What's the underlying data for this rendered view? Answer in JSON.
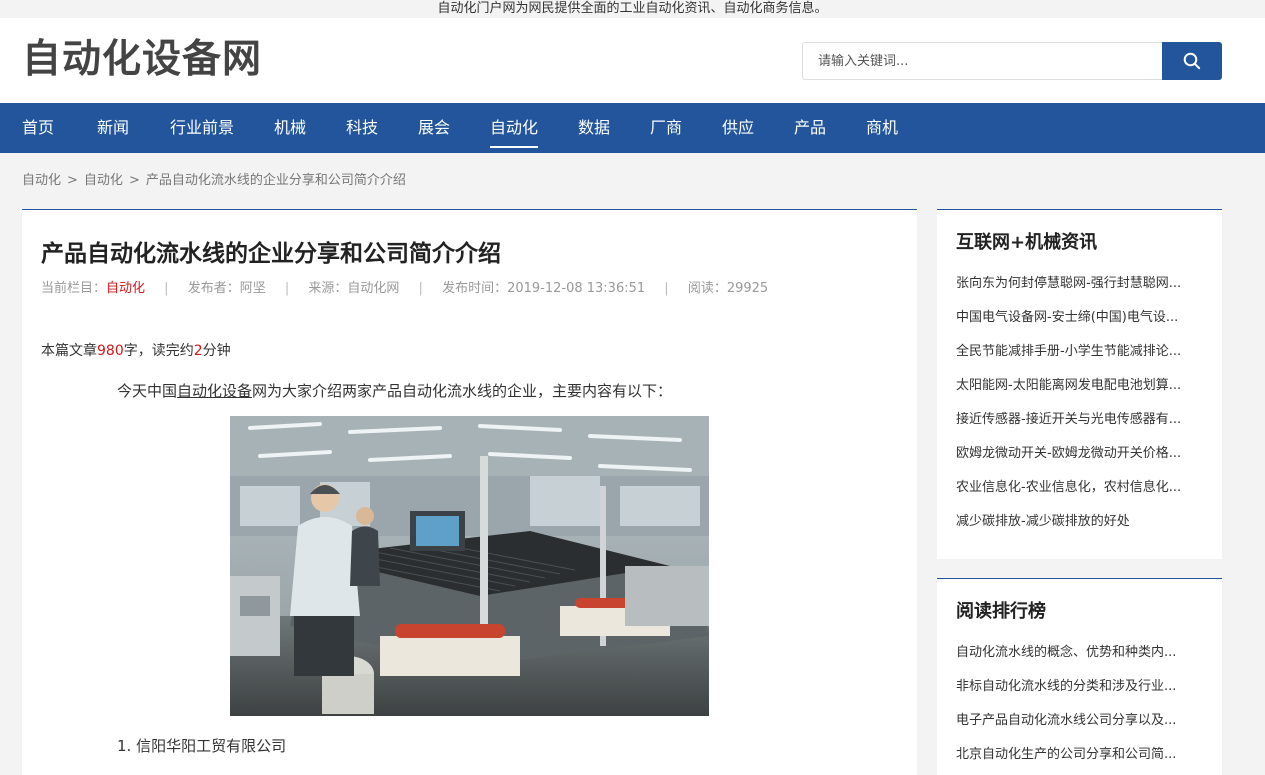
{
  "topbar": {
    "text": "自动化门户网为网民提供全面的工业自动化资讯、自动化商务信息。"
  },
  "header": {
    "logo": "自动化设备网",
    "search_placeholder": "请输入关键词..."
  },
  "nav": {
    "items": [
      "首页",
      "新闻",
      "行业前景",
      "机械",
      "科技",
      "展会",
      "自动化",
      "数据",
      "厂商",
      "供应",
      "产品",
      "商机"
    ],
    "active": "自动化"
  },
  "breadcrumb": {
    "items": [
      "自动化",
      "自动化",
      "产品自动化流水线的企业分享和公司简介介绍"
    ],
    "sep": ">"
  },
  "article": {
    "title": "产品自动化流水线的企业分享和公司简介介绍",
    "meta": {
      "column_label": "当前栏目：",
      "column": "自动化",
      "author": "发布者：阿坚",
      "source": "来源：自动化网",
      "time": "发布时间：2019-12-08 13:36:51",
      "reads": "阅读：29925",
      "sep": "|"
    },
    "wordcount": {
      "prefix": "本篇文章",
      "chars": "980",
      "mid": "字，读完约",
      "minutes": "2",
      "suffix": "分钟"
    },
    "intro": {
      "before": "今天中国",
      "link": "自动化设备",
      "after": "网为大家介绍两家产品自动化流水线的企业，主要内容有以下："
    },
    "item1": "1. 信阳华阳工贸有限公司"
  },
  "sidebar": {
    "panel1": {
      "title": "互联网+机械资讯",
      "items": [
        "张向东为何封停慧聪网-强行封慧聪网...",
        "中国电气设备网-安士缔(中国)电气设...",
        "全民节能减排手册-小学生节能减排论...",
        "太阳能网-太阳能离网发电配电池划算...",
        "接近传感器-接近开关与光电传感器有...",
        "欧姆龙微动开关-欧姆龙微动开关价格...",
        "农业信息化-农业信息化，农村信息化...",
        "减少碳排放-减少碳排放的好处"
      ]
    },
    "panel2": {
      "title": "阅读排行榜",
      "items": [
        "自动化流水线的概念、优势和种类内...",
        "非标自动化流水线的分类和涉及行业...",
        "电子产品自动化流水线公司分享以及...",
        "北京自动化生产的公司分享和公司简..."
      ]
    }
  },
  "colors": {
    "brand": "#22559c",
    "highlight": "#d0171b"
  }
}
